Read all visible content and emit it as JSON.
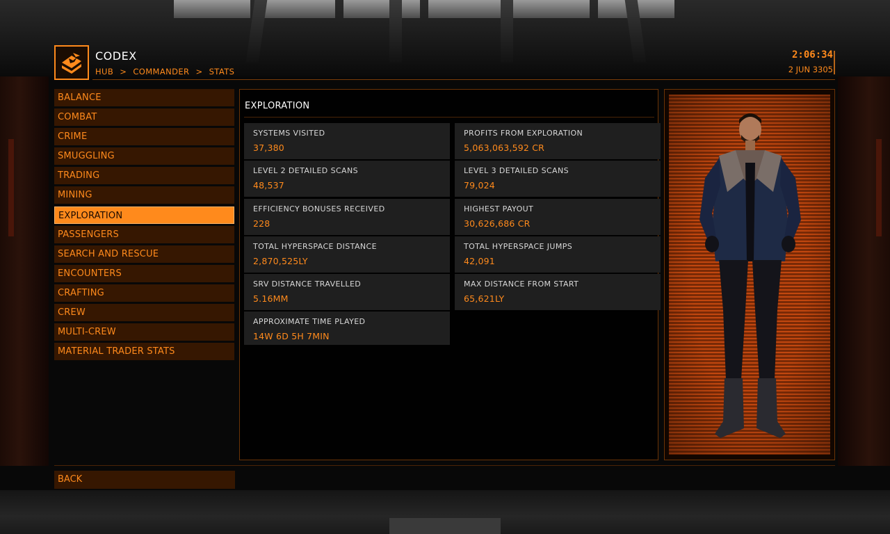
{
  "header": {
    "title": "CODEX",
    "breadcrumb": [
      "HUB",
      "COMMANDER",
      "STATS"
    ],
    "breadcrumb_separator": ">",
    "time": "2:06:34",
    "date": "2 JUN 3305",
    "logo_icon": "codex-book-icon"
  },
  "menu": {
    "items": [
      {
        "label": "BALANCE",
        "active": false
      },
      {
        "label": "COMBAT",
        "active": false
      },
      {
        "label": "CRIME",
        "active": false
      },
      {
        "label": "SMUGGLING",
        "active": false
      },
      {
        "label": "TRADING",
        "active": false
      },
      {
        "label": "MINING",
        "active": false
      },
      {
        "label": "EXPLORATION",
        "active": true
      },
      {
        "label": "PASSENGERS",
        "active": false
      },
      {
        "label": "SEARCH AND RESCUE",
        "active": false
      },
      {
        "label": "ENCOUNTERS",
        "active": false
      },
      {
        "label": "CRAFTING",
        "active": false
      },
      {
        "label": "CREW",
        "active": false
      },
      {
        "label": "MULTI-CREW",
        "active": false
      },
      {
        "label": "MATERIAL TRADER STATS",
        "active": false
      }
    ]
  },
  "panel": {
    "title": "EXPLORATION",
    "stats": [
      {
        "label": "SYSTEMS VISITED",
        "value": "37,380"
      },
      {
        "label": "PROFITS FROM EXPLORATION",
        "value": "5,063,063,592 CR"
      },
      {
        "label": "LEVEL 2 DETAILED SCANS",
        "value": "48,537"
      },
      {
        "label": "LEVEL 3 DETAILED SCANS",
        "value": "79,024"
      },
      {
        "label": "EFFICIENCY BONUSES RECEIVED",
        "value": "228"
      },
      {
        "label": "HIGHEST PAYOUT",
        "value": "30,626,686 CR"
      },
      {
        "label": "TOTAL HYPERSPACE DISTANCE",
        "value": "2,870,525LY"
      },
      {
        "label": "TOTAL HYPERSPACE JUMPS",
        "value": "42,091"
      },
      {
        "label": "SRV DISTANCE TRAVELLED",
        "value": "5.16MM"
      },
      {
        "label": "MAX DISTANCE FROM START",
        "value": "65,621LY"
      },
      {
        "label": "APPROXIMATE TIME PLAYED",
        "value": "14W 6D 5H 7MIN"
      }
    ]
  },
  "footer": {
    "back_label": "BACK"
  },
  "colors": {
    "accent": "#ff8a1c",
    "menu_bg": "#361701",
    "cell_bg": "#1f1f1f",
    "border": "#6b3306"
  }
}
